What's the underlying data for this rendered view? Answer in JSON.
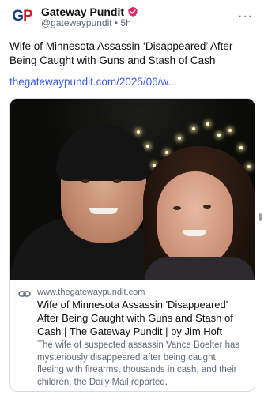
{
  "post": {
    "author_name": "Gateway Pundit",
    "author_handle": "@gatewaypundit",
    "time_ago": "5h",
    "avatar_text_blue": "G",
    "avatar_text_red": "P",
    "text": "Wife of Minnesota Assassin ‘Disappeared’ After Being Caught with Guns and Stash of Cash",
    "link_text": "thegatewaypundit.com/2025/06/w...",
    "verified_icon": "verified-check-icon",
    "more_icon": "more-options-icon"
  },
  "card": {
    "domain": "www.thegatewaypundit.com",
    "title": "Wife of Minnesota Assassin 'Disappeared' After Being Caught with Guns and Stash of Cash | The Gateway Pundit | by Jim Hoft",
    "description": "The wife of suspected assassin Vance Boelter has mysteriously disappeared after being caught fleeing with firearms, thousands in cash, and their children, the Daily Mail reported.",
    "link_icon": "link-chain-icon"
  },
  "colors": {
    "link": "#3b5bdb",
    "verified": "#e0245e",
    "brand_blue": "#1a3e7c",
    "brand_red": "#d32027"
  }
}
